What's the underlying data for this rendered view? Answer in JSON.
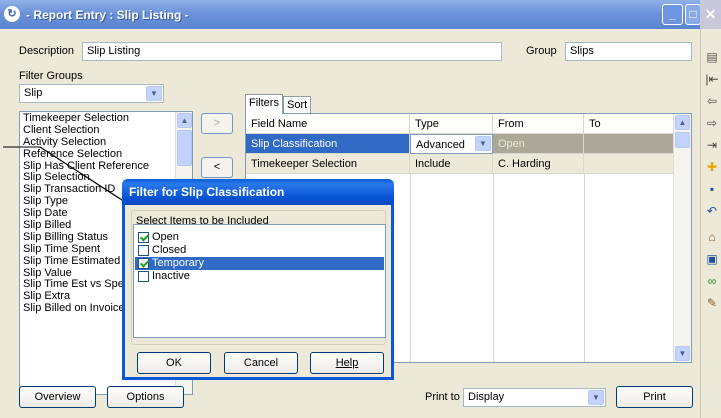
{
  "window": {
    "title": "- Report Entry : Slip Listing -"
  },
  "header": {
    "description_label": "Description",
    "description_value": "Slip Listing",
    "group_label": "Group",
    "group_value": "Slips",
    "filter_groups_label": "Filter Groups",
    "filter_groups_value": "Slip"
  },
  "filter_list": {
    "items": [
      "Timekeeper Selection",
      "Client Selection",
      "Activity Selection",
      "Reference Selection",
      "Slip Has Client Reference",
      "Slip Selection",
      "Slip Transaction ID",
      "Slip Type",
      "Slip Date",
      "Slip Billed",
      "Slip Billing Status",
      "Slip Time Spent",
      "Slip Time Estimated",
      "Slip Value",
      "Slip Time Est vs Spent",
      "Slip Extra",
      "Slip Billed on Invoice"
    ]
  },
  "move_buttons": {
    "add": ">",
    "remove": "<"
  },
  "tabs": {
    "filters": "Filters",
    "sort": "Sort"
  },
  "grid": {
    "columns": [
      "Field Name",
      "Type",
      "From",
      "To"
    ],
    "rows": [
      {
        "field": "Slip Classification",
        "type": "Advanced",
        "from": "Open",
        "to": ""
      },
      {
        "field": "Timekeeper Selection",
        "type": "Include",
        "from": "C. Harding",
        "to": ""
      }
    ]
  },
  "dialog": {
    "title": "Filter for Slip Classification",
    "group_label": "Select Items to be Included",
    "items": [
      {
        "label": "Open",
        "checked": true,
        "selected": false
      },
      {
        "label": "Closed",
        "checked": false,
        "selected": false
      },
      {
        "label": "Temporary",
        "checked": true,
        "selected": true
      },
      {
        "label": "Inactive",
        "checked": false,
        "selected": false
      }
    ],
    "ok": "OK",
    "cancel": "Cancel",
    "help": "Help"
  },
  "footer": {
    "overview": "Overview",
    "options": "Options",
    "print_to_label": "Print to",
    "print_to_value": "Display",
    "print": "Print"
  },
  "colors": {
    "selection": "#316ac5",
    "dialog_title": "#0a58d8",
    "window_title": "#6c92d9"
  }
}
